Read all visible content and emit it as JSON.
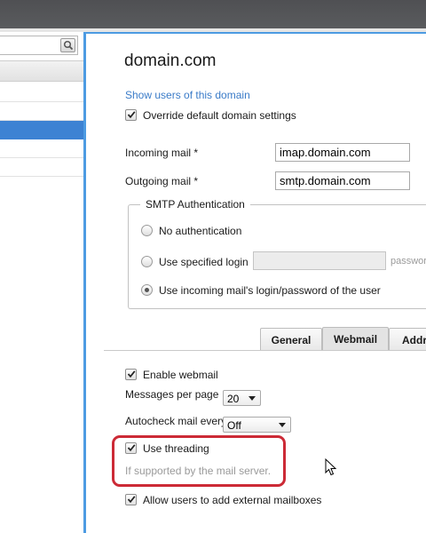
{
  "domain": {
    "title": "domain.com",
    "show_users_link": "Show users of this domain",
    "override_label": "Override default domain settings",
    "override_checked": true
  },
  "mail": {
    "incoming_label": "Incoming mail *",
    "incoming_value": "imap.domain.com",
    "outgoing_label": "Outgoing mail *",
    "outgoing_value": "smtp.domain.com"
  },
  "smtp": {
    "legend": "SMTP Authentication",
    "options": [
      {
        "label": "No authentication",
        "checked": false
      },
      {
        "label": "Use specified login",
        "checked": false
      },
      {
        "label": "Use incoming mail's login/password of the user",
        "checked": true
      }
    ],
    "password_placeholder": "password"
  },
  "tabs": [
    {
      "label": "General",
      "active": false
    },
    {
      "label": "Webmail",
      "active": true
    },
    {
      "label": "Addr",
      "active": false
    }
  ],
  "webmail": {
    "enable_label": "Enable webmail",
    "enable_checked": true,
    "messages_per_page_label": "Messages per page",
    "messages_per_page_value": "20",
    "autocheck_label": "Autocheck mail every",
    "autocheck_value": "Off",
    "threading_label": "Use threading",
    "threading_checked": true,
    "threading_hint": "If supported by the mail server.",
    "external_label": "Allow users to add external mailboxes",
    "external_checked": true
  },
  "colors": {
    "accent_blue": "#4d9be2",
    "selection_blue": "#3d82d3",
    "highlight_red": "#cc2a36",
    "link_blue": "#3a7bc8"
  },
  "icons": {
    "search": "search-icon",
    "checkmark": "checkmark-icon",
    "cursor": "mouse-cursor-icon"
  }
}
